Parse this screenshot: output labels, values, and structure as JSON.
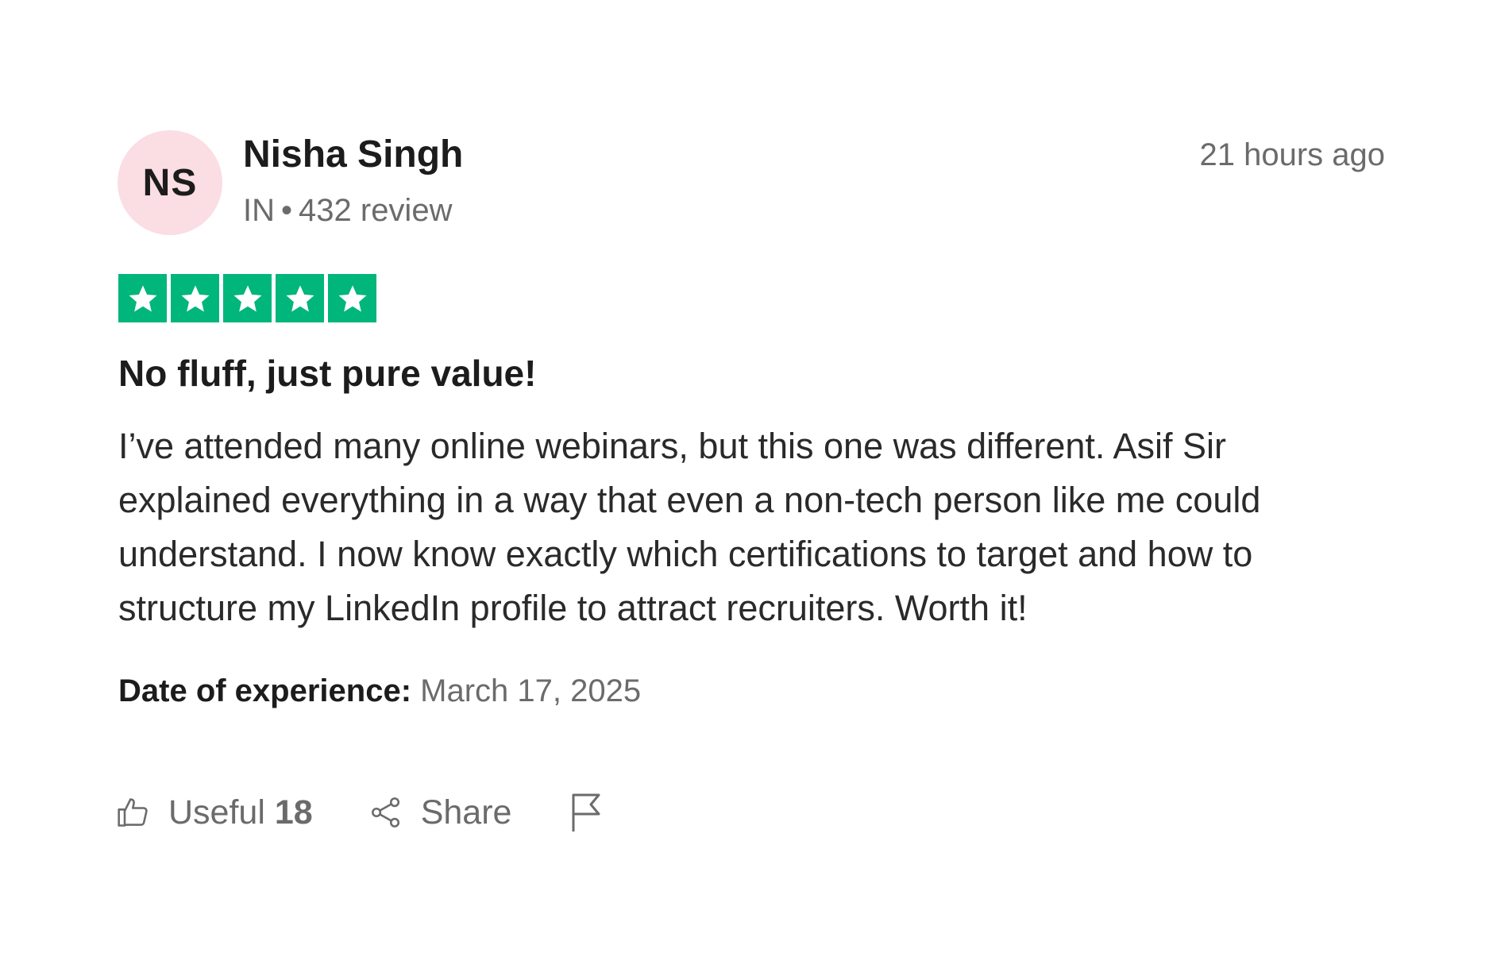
{
  "review": {
    "avatar_initials": "NS",
    "avatar_color": "#fbdde4",
    "reviewer_name": "Nisha Singh",
    "country": "IN",
    "separator": "•",
    "review_count": "432 review",
    "time_ago": "21 hours ago",
    "rating": 5,
    "rating_max": 5,
    "star_color": "#00b67a",
    "title": "No fluff, just pure value!",
    "text": "I’ve attended many online webinars, but this one was different. Asif Sir explained everything in a way that even a non-tech person like me could understand. I now know exactly which certifications to target and how to structure my LinkedIn profile to attract recruiters. Worth it!",
    "date_label": "Date of experience:",
    "date_value": "March 17, 2025"
  },
  "actions": {
    "useful_label": "Useful",
    "useful_count": "18",
    "share_label": "Share",
    "useful_icon": "thumbs-up-icon",
    "share_icon": "share-icon",
    "flag_icon": "flag-icon"
  }
}
